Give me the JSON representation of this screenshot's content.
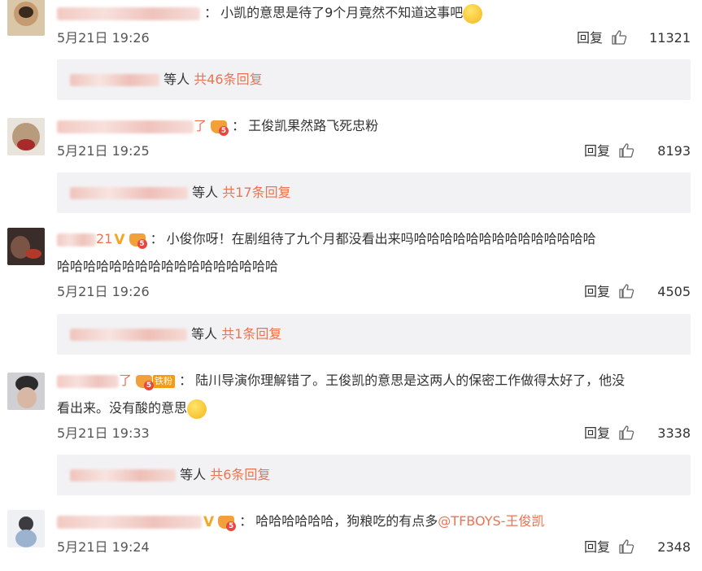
{
  "comments": [
    {
      "id": "c1",
      "username_suffix": "",
      "verified": false,
      "crown": false,
      "fan_badge": "",
      "text_line1": "小凯的意思是待了9个月竟然不知道这事吧",
      "text_line2": "",
      "mention": "",
      "emoji": "laugh-cry-emoji",
      "time": "5月21日 19:26",
      "reply_label": "回复",
      "likes": "11321",
      "sub_replies": {
        "suffix": "等人",
        "count_text": "共46条回复"
      }
    },
    {
      "id": "c2",
      "username_suffix": "了",
      "verified": false,
      "crown": true,
      "fan_badge": "",
      "text_line1": "王俊凯果然路飞死忠粉",
      "text_line2": "",
      "mention": "",
      "emoji": "",
      "time": "5月21日 19:25",
      "reply_label": "回复",
      "likes": "8193",
      "sub_replies": {
        "suffix": "等人",
        "count_text": "共17条回复"
      }
    },
    {
      "id": "c3",
      "username_suffix": "21",
      "verified": true,
      "crown": true,
      "fan_badge": "",
      "text_line1": "小俊你呀！在剧组待了九个月都没看出来吗哈哈哈哈哈哈哈哈哈哈哈哈哈哈",
      "text_line2": "哈哈哈哈哈哈哈哈哈哈哈哈哈哈哈哈哈",
      "mention": "",
      "emoji": "",
      "time": "5月21日 19:26",
      "reply_label": "回复",
      "likes": "4505",
      "sub_replies": {
        "suffix": "等人",
        "count_text": "共1条回复"
      }
    },
    {
      "id": "c4",
      "username_suffix": "了",
      "verified": false,
      "crown": true,
      "fan_badge": "铁粉",
      "text_line1": "陆川导演你理解错了。王俊凯的意思是这两人的保密工作做得太好了，他没",
      "text_line2": "看出来。没有酸的意思",
      "mention": "",
      "emoji": "thinking-emoji",
      "time": "5月21日 19:33",
      "reply_label": "回复",
      "likes": "3338",
      "sub_replies": {
        "suffix": "等人",
        "count_text": "共6条回复"
      }
    },
    {
      "id": "c5",
      "username_suffix": "",
      "verified": true,
      "crown": true,
      "fan_badge": "",
      "text_line1": "哈哈哈哈哈哈，狗粮吃的有点多",
      "text_line2": "",
      "mention": "@TFBOYS-王俊凯",
      "emoji": "",
      "time": "5月21日 19:24",
      "reply_label": "回复",
      "likes": "2348",
      "sub_replies": null
    }
  ],
  "colors": {
    "accent": "#eb7350",
    "verified": "#f5a623",
    "sub_box_bg": "#f2f2f5"
  }
}
